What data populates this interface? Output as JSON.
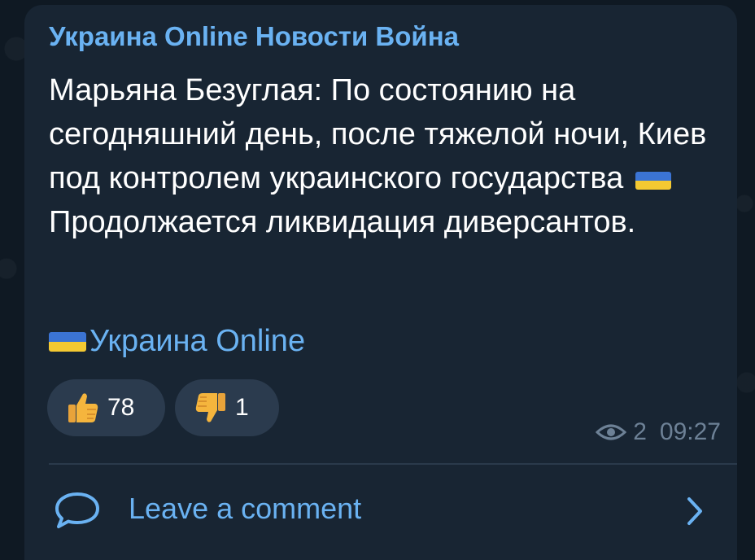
{
  "post": {
    "channel_name": "Украина Online Новости Война",
    "text_before_flag": "Марьяна Безуглая: По состоянию на сегодняшний день, после тяжелой ночи, Киев под контролем украинского государства",
    "text_after_flag": "Продолжается ликвидация диверсантов.",
    "signature": "Украина Online"
  },
  "reactions": [
    {
      "emoji": "thumbs-up",
      "count": "78"
    },
    {
      "emoji": "thumbs-down",
      "count": "1"
    }
  ],
  "meta": {
    "views": "2",
    "time": "09:27"
  },
  "comments": {
    "label": "Leave a comment"
  },
  "colors": {
    "background": "#0f1923",
    "bubble": "#182533",
    "accent": "#6ab2f2",
    "text": "#ffffff",
    "meta": "#6d8196",
    "flag_blue": "#3b74d4",
    "flag_yellow": "#f4c932"
  }
}
